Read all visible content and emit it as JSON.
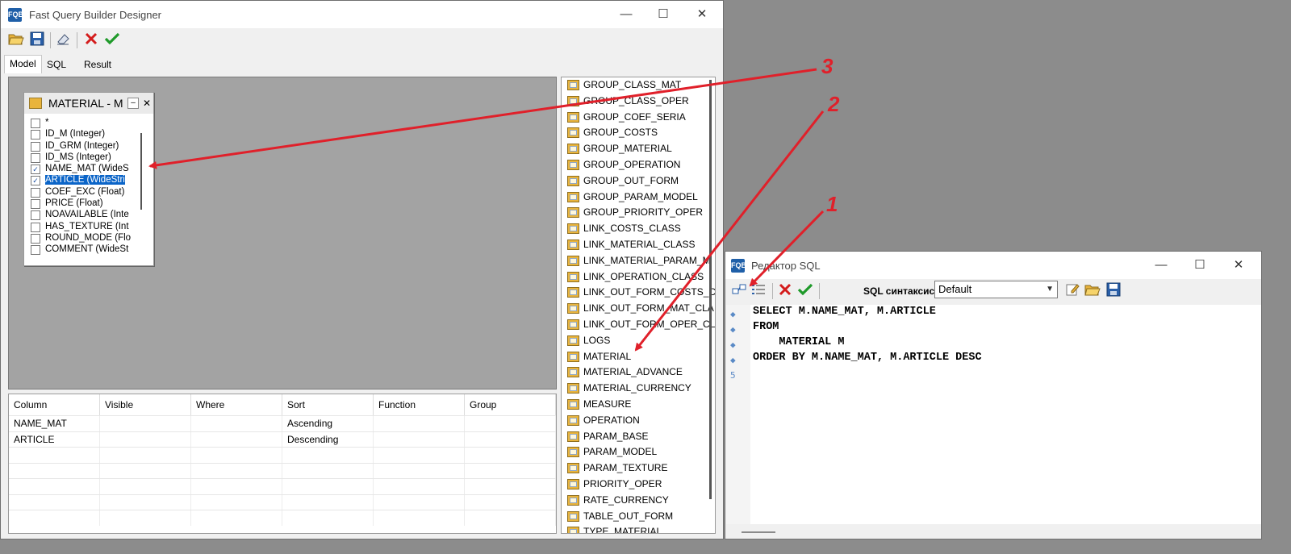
{
  "main_window": {
    "title": "Fast Query Builder  Designer",
    "icon_label": "FQB",
    "controls": {
      "minimize": "—",
      "maximize": "☐",
      "close": "✕"
    },
    "toolbar": [
      "open-icon",
      "save-icon",
      "clear-icon",
      "cancel-icon",
      "ok-icon"
    ],
    "tabs": [
      "Model",
      "SQL",
      "Result"
    ],
    "active_tab": "Model"
  },
  "table_box": {
    "title": "MATERIAL - M",
    "min": "–",
    "close": "✕",
    "fields": [
      {
        "name": "*",
        "checked": false,
        "selected": false
      },
      {
        "name": "ID_M (Integer)",
        "checked": false,
        "selected": false
      },
      {
        "name": "ID_GRM (Integer)",
        "checked": false,
        "selected": false
      },
      {
        "name": "ID_MS (Integer)",
        "checked": false,
        "selected": false
      },
      {
        "name": "NAME_MAT (WideS",
        "checked": true,
        "selected": false
      },
      {
        "name": "ARTICLE (WideStri",
        "checked": true,
        "selected": true
      },
      {
        "name": "COEF_EXC (Float)",
        "checked": false,
        "selected": false
      },
      {
        "name": "PRICE (Float)",
        "checked": false,
        "selected": false
      },
      {
        "name": "NOAVAILABLE (Inte",
        "checked": false,
        "selected": false
      },
      {
        "name": "HAS_TEXTURE (Int",
        "checked": false,
        "selected": false
      },
      {
        "name": "ROUND_MODE (Flo",
        "checked": false,
        "selected": false
      },
      {
        "name": "COMMENT (WideSt",
        "checked": false,
        "selected": false
      }
    ]
  },
  "grid": {
    "columns": [
      "Column",
      "Visible",
      "Where",
      "Sort",
      "Function",
      "Group"
    ],
    "rows": [
      [
        "NAME_MAT",
        "",
        "",
        "Ascending",
        "",
        ""
      ],
      [
        "ARTICLE",
        "",
        "",
        "Descending",
        "",
        ""
      ]
    ]
  },
  "tables_list": [
    "GROUP_CLASS_MAT",
    "GROUP_CLASS_OPER",
    "GROUP_COEF_SERIA",
    "GROUP_COSTS",
    "GROUP_MATERIAL",
    "GROUP_OPERATION",
    "GROUP_OUT_FORM",
    "GROUP_PARAM_MODEL",
    "GROUP_PRIORITY_OPER",
    "LINK_COSTS_CLASS",
    "LINK_MATERIAL_CLASS",
    "LINK_MATERIAL_PARAM_M",
    "LINK_OPERATION_CLASS",
    "LINK_OUT_FORM_COSTS_C",
    "LINK_OUT_FORM_MAT_CLA",
    "LINK_OUT_FORM_OPER_CL",
    "LOGS",
    "MATERIAL",
    "MATERIAL_ADVANCE",
    "MATERIAL_CURRENCY",
    "MEASURE",
    "OPERATION",
    "PARAM_BASE",
    "PARAM_MODEL",
    "PARAM_TEXTURE",
    "PRIORITY_OPER",
    "RATE_CURRENCY",
    "TABLE_OUT_FORM",
    "TYPE_MATERIAL"
  ],
  "sql_window": {
    "title": "Редактор SQL",
    "icon_label": "FQB",
    "controls": {
      "minimize": "—",
      "maximize": "☐",
      "close": "✕"
    },
    "syntax_label": "SQL синтаксис:",
    "syntax_value": "Default",
    "gutter": [
      "◆",
      "◆",
      "◆",
      "◆",
      "5"
    ],
    "lines": [
      "SELECT M.NAME_MAT, M.ARTICLE",
      "FROM",
      "    MATERIAL M",
      "ORDER BY M.NAME_MAT, M.ARTICLE DESC"
    ]
  },
  "annotations": {
    "a1": "1",
    "a2": "2",
    "a3": "3",
    "color": "#e0202a"
  }
}
